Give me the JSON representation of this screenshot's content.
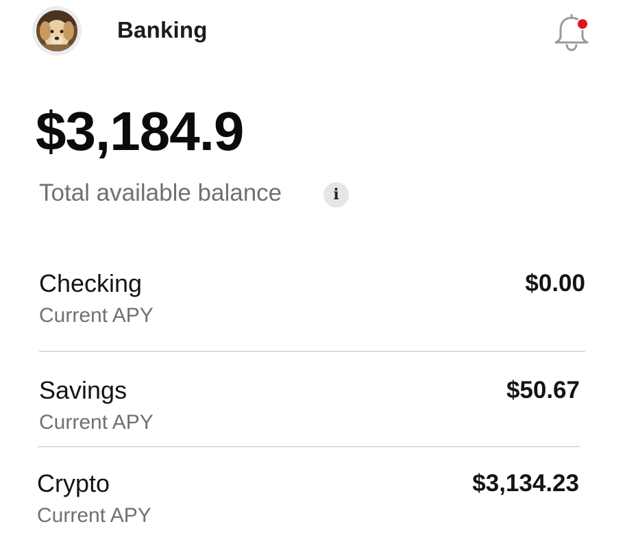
{
  "header": {
    "title": "Banking",
    "avatar_icon": "dog-photo-avatar",
    "notification_icon": "bell-icon",
    "notification_dot_color": "#e0161e"
  },
  "balance": {
    "amount": "$3,184.9",
    "label": "Total available balance",
    "info_icon_glyph": "i"
  },
  "accounts": [
    {
      "name": "Checking",
      "subtitle": "Current APY",
      "amount": "$0.00"
    },
    {
      "name": "Savings",
      "subtitle": "Current APY",
      "amount": "$50.67"
    },
    {
      "name": "Crypto",
      "subtitle": "Current APY",
      "amount": "$3,134.23"
    }
  ]
}
